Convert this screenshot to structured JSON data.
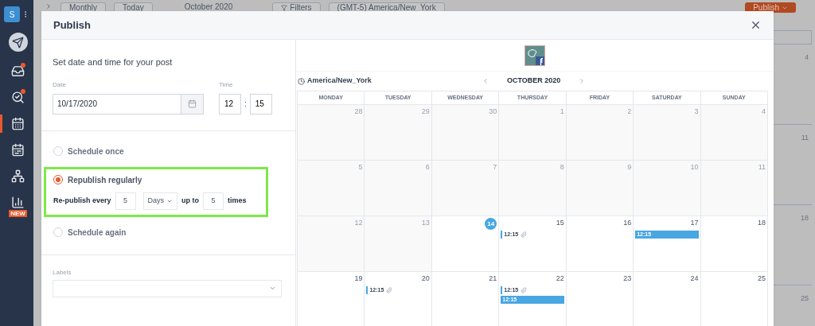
{
  "sidebar": {
    "avatar": "S",
    "items": [
      {
        "kind": "send",
        "selected": false,
        "alert": false
      },
      {
        "kind": "inbox",
        "selected": false,
        "alert": true
      },
      {
        "kind": "listen",
        "selected": false,
        "alert": true
      },
      {
        "kind": "calendar",
        "selected": true,
        "alert": false
      },
      {
        "kind": "planner",
        "selected": false,
        "alert": false
      },
      {
        "kind": "team",
        "selected": false,
        "alert": false
      },
      {
        "kind": "reports",
        "selected": false,
        "alert": false,
        "badge": "NEW"
      }
    ]
  },
  "toolbar": {
    "view": "Monthly",
    "today": "Today",
    "month": "October 2020",
    "filters": "Filters",
    "timezone": "(GMT-5) America/New_York",
    "publish": "Publish"
  },
  "background_calendar": {
    "days": [
      "4",
      "11",
      "18",
      "25"
    ]
  },
  "dialog": {
    "title": "Publish",
    "heading": "Set date and time for your post",
    "date": {
      "label": "Date",
      "value": "10/17/2020"
    },
    "time": {
      "label": "Time",
      "hour": "12",
      "separator": ":",
      "minute": "15"
    },
    "options": [
      {
        "label": "Schedule once",
        "selected": false,
        "highlighted": false
      },
      {
        "label": "Republish regularly",
        "selected": true,
        "highlighted": true,
        "repeat": {
          "prefix": "Re-publish every",
          "every": "5",
          "unit": "Days",
          "middle": "up to",
          "count": "5",
          "suffix": "times"
        }
      },
      {
        "label": "Schedule again",
        "selected": false,
        "highlighted": false
      }
    ],
    "labels": {
      "label": "Labels"
    },
    "calendar": {
      "timezone": "America/New_York",
      "month": "OCTOBER 2020",
      "weekdays": [
        "MONDAY",
        "TUESDAY",
        "WEDNESDAY",
        "THURSDAY",
        "FRIDAY",
        "SATURDAY",
        "SUNDAY"
      ],
      "weeks": [
        [
          {
            "day": "28",
            "past": true,
            "today": false
          },
          {
            "day": "29",
            "past": true,
            "today": false
          },
          {
            "day": "30",
            "past": true,
            "today": false
          },
          {
            "day": "1",
            "past": true,
            "today": false
          },
          {
            "day": "2",
            "past": true,
            "today": false
          },
          {
            "day": "3",
            "past": true,
            "today": false
          },
          {
            "day": "4",
            "past": true,
            "today": false
          }
        ],
        [
          {
            "day": "5",
            "past": true,
            "today": false
          },
          {
            "day": "6",
            "past": true,
            "today": false
          },
          {
            "day": "7",
            "past": true,
            "today": false
          },
          {
            "day": "8",
            "past": true,
            "today": false
          },
          {
            "day": "9",
            "past": true,
            "today": false
          },
          {
            "day": "10",
            "past": true,
            "today": false
          },
          {
            "day": "11",
            "past": true,
            "today": false
          }
        ],
        [
          {
            "day": "12",
            "past": true,
            "today": false
          },
          {
            "day": "13",
            "past": true,
            "today": false
          },
          {
            "day": "14",
            "past": false,
            "today": true
          },
          {
            "day": "15",
            "past": false,
            "today": false,
            "events": [
              {
                "time": "12:15",
                "kind": "draft"
              }
            ]
          },
          {
            "day": "16",
            "past": false,
            "today": false
          },
          {
            "day": "17",
            "past": false,
            "today": false,
            "events": [
              {
                "time": "12:15",
                "kind": "scheduled"
              }
            ]
          },
          {
            "day": "18",
            "past": false,
            "today": false
          }
        ],
        [
          {
            "day": "19",
            "past": false,
            "today": false
          },
          {
            "day": "20",
            "past": false,
            "today": false,
            "events": [
              {
                "time": "12:15",
                "kind": "draft"
              }
            ]
          },
          {
            "day": "21",
            "past": false,
            "today": false
          },
          {
            "day": "22",
            "past": false,
            "today": false,
            "events": [
              {
                "time": "12:15",
                "kind": "draft"
              },
              {
                "time": "12:15",
                "kind": "scheduled"
              }
            ]
          },
          {
            "day": "23",
            "past": false,
            "today": false
          },
          {
            "day": "24",
            "past": false,
            "today": false
          },
          {
            "day": "25",
            "past": false,
            "today": false
          }
        ]
      ]
    }
  }
}
